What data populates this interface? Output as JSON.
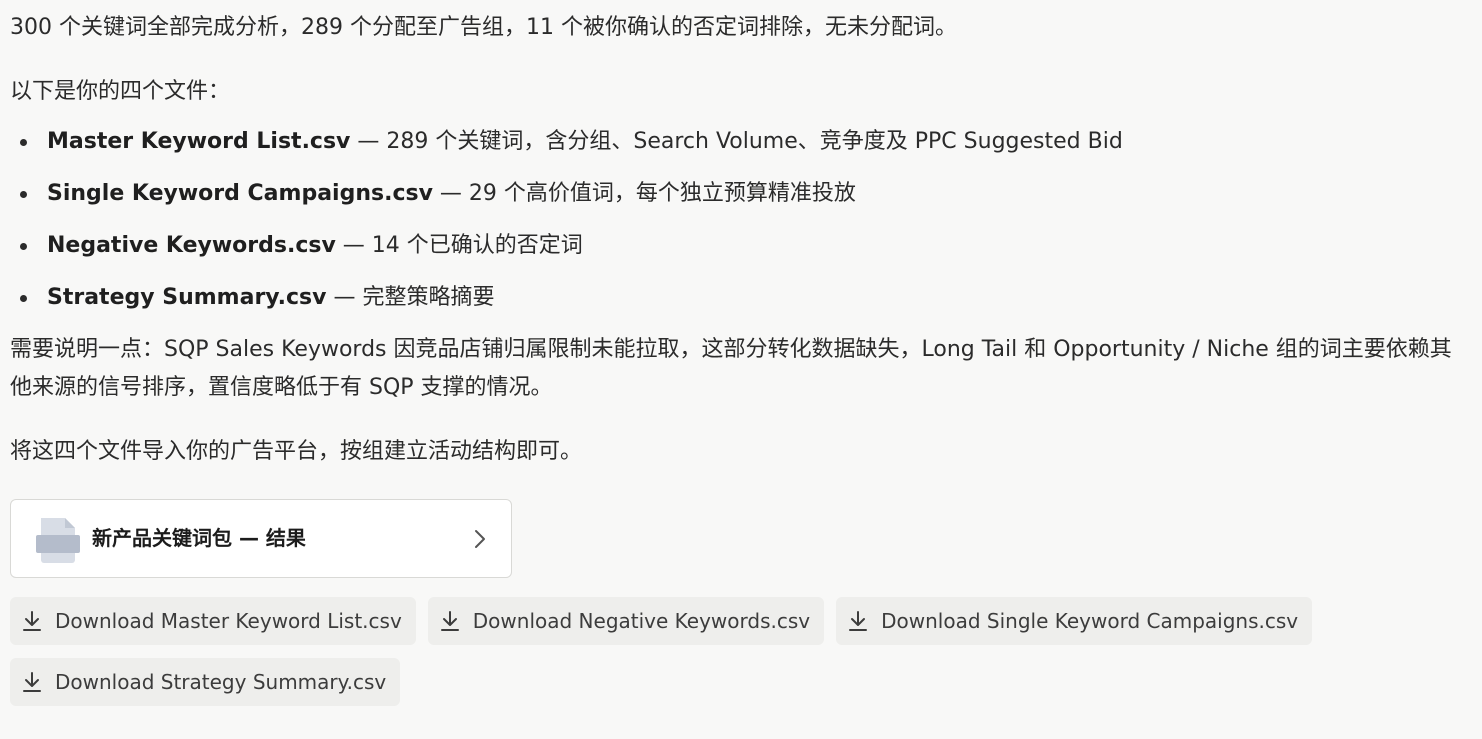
{
  "message": {
    "summary": "300 个关键词全部完成分析，289 个分配至广告组，11 个被你确认的否定词排除，无未分配词。",
    "files_intro": "以下是你的四个文件：",
    "files": [
      {
        "name": "Master Keyword List.csv",
        "desc": " — 289 个关键词，含分组、Search Volume、竞争度及 PPC Suggested Bid"
      },
      {
        "name": "Single Keyword Campaigns.csv",
        "desc": " — 29 个高价值词，每个独立预算精准投放"
      },
      {
        "name": "Negative Keywords.csv",
        "desc": " — 14 个已确认的否定词"
      },
      {
        "name": "Strategy Summary.csv",
        "desc": " — 完整策略摘要"
      }
    ],
    "note": "需要说明一点：SQP Sales Keywords 因竞品店铺归属限制未能拉取，这部分转化数据缺失，Long Tail 和 Opportunity / Niche 组的词主要依赖其他来源的信号排序，置信度略低于有 SQP 支撑的情况。",
    "closing": "将这四个文件导入你的广告平台，按组建立活动结构即可。"
  },
  "artifact": {
    "title": "新产品关键词包 — 结果",
    "icon": "document-icon"
  },
  "downloads": [
    {
      "label": "Download Master Keyword List.csv",
      "icon": "download-icon"
    },
    {
      "label": "Download Negative Keywords.csv",
      "icon": "download-icon"
    },
    {
      "label": "Download Single Keyword Campaigns.csv",
      "icon": "download-icon"
    },
    {
      "label": "Download Strategy Summary.csv",
      "icon": "download-icon"
    }
  ],
  "colors": {
    "background": "#f8f8f7",
    "text": "#2b2b2b",
    "card_border": "#d9d9d6",
    "button_bg": "#eeeeec",
    "icon_gray": "#b4bccb"
  }
}
